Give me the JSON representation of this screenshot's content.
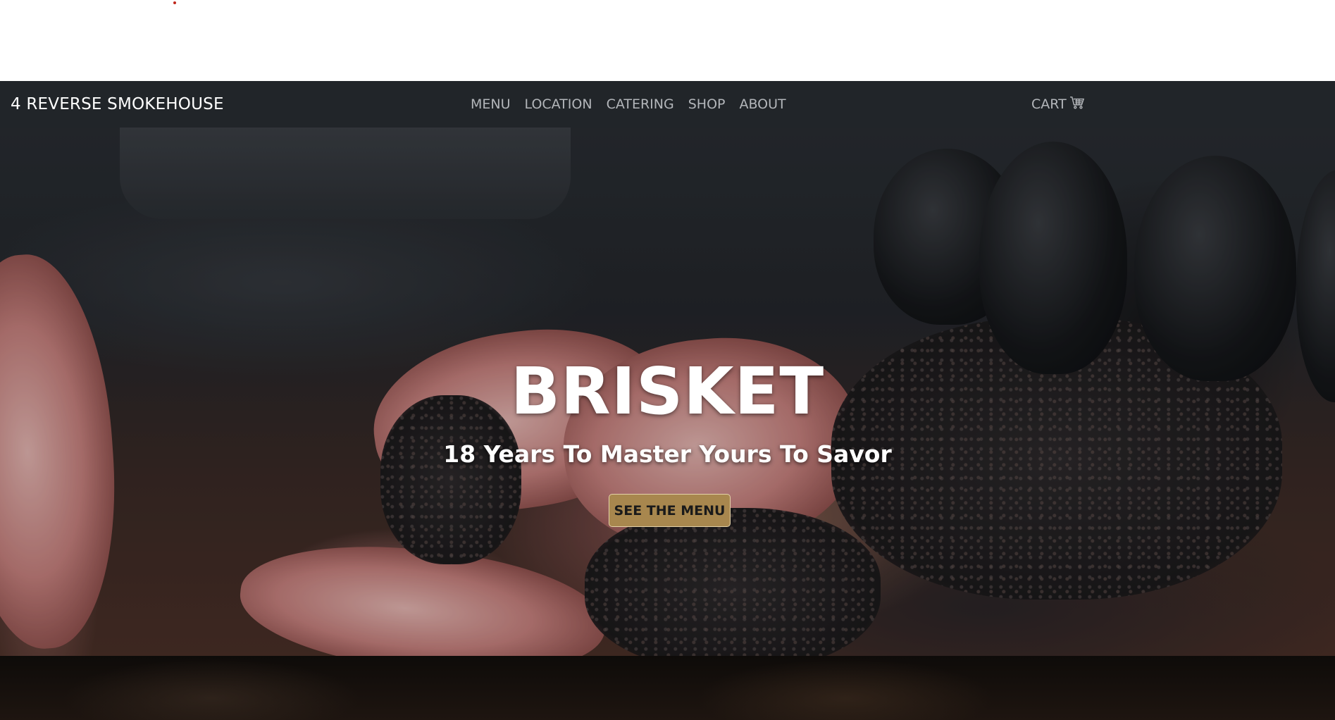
{
  "navbar": {
    "brand": "4 REVERSE SMOKEHOUSE",
    "links": [
      "MENU",
      "LOCATION",
      "CATERING",
      "SHOP",
      "ABOUT"
    ],
    "cart_label": "CART",
    "cart_icon": "shopping-cart-icon"
  },
  "hero": {
    "title": "BRISKET",
    "subtitle": "18 Years To Master Yours To Savor",
    "button_label": "SEE THE MENU"
  },
  "colors": {
    "navbar_bg": "#212529",
    "nav_link": "#b3b6ba",
    "button_bg": "#a8874e",
    "button_border": "#e4d2a8"
  }
}
